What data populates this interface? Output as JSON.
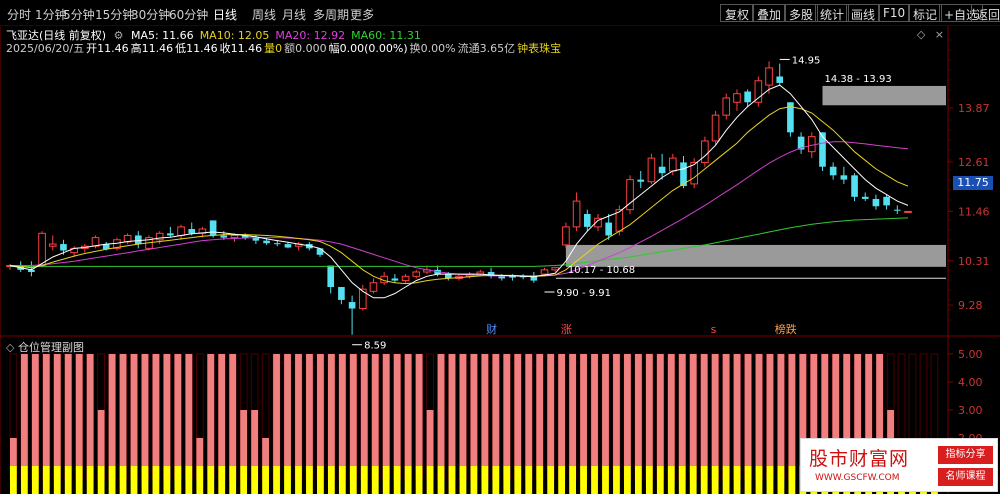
{
  "toolbar": {
    "periods": [
      "分时",
      "1分钟",
      "5分钟",
      "15分钟",
      "30分钟",
      "60分钟",
      "日线",
      "周线",
      "月线",
      "多周期",
      "更多"
    ],
    "active_period": "日线",
    "more_arrow": "›",
    "right_buttons": [
      "复权",
      "叠加",
      "多股",
      "统计",
      "画线",
      "F10",
      "标记",
      "+自选",
      "返回"
    ]
  },
  "info": {
    "stock": "飞亚达(日线 前复权)",
    "ma_items": [
      {
        "label": "MA5: 11.66",
        "color": "#ffffff"
      },
      {
        "label": "MA10: 12.05",
        "color": "#e6d21e"
      },
      {
        "label": "MA20: 12.92",
        "color": "#e040e0"
      },
      {
        "label": "MA60: 11.31",
        "color": "#32d232"
      }
    ],
    "line2": [
      {
        "text": "2025/06/20/五",
        "color": "#cccccc"
      },
      {
        "text": "开11.46",
        "color": "#ffffff"
      },
      {
        "text": "高11.46",
        "color": "#ffffff"
      },
      {
        "text": "低11.46",
        "color": "#ffffff"
      },
      {
        "text": "收11.46",
        "color": "#ffffff"
      },
      {
        "text": "量0",
        "color": "#e6d21e"
      },
      {
        "text": "额0.000",
        "color": "#cccccc"
      },
      {
        "text": "幅0.00(0.00%)",
        "color": "#ffffff"
      },
      {
        "text": "换0.00%",
        "color": "#cccccc"
      },
      {
        "text": "流通3.65亿",
        "color": "#cccccc"
      },
      {
        "text": "钟表珠宝",
        "color": "#e6d21e"
      }
    ]
  },
  "chart_data": {
    "type": "candlestick",
    "ylim": [
      8.7,
      15.1
    ],
    "y_ticks": [
      "13.87",
      "12.61",
      "11.46",
      "10.31",
      "9.28"
    ],
    "y_tick_values": [
      13.87,
      12.61,
      11.46,
      10.31,
      9.28
    ],
    "current_price": "11.75",
    "candles": [
      [
        10.18,
        10.24,
        10.1,
        10.2
      ],
      [
        10.2,
        10.3,
        10.05,
        10.1
      ],
      [
        10.1,
        10.3,
        9.95,
        10.05
      ],
      [
        10.2,
        11.0,
        10.15,
        10.95
      ],
      [
        10.65,
        10.9,
        10.55,
        10.7
      ],
      [
        10.7,
        10.8,
        10.45,
        10.55
      ],
      [
        10.5,
        10.65,
        10.4,
        10.6
      ],
      [
        10.6,
        10.7,
        10.5,
        10.65
      ],
      [
        10.65,
        10.9,
        10.6,
        10.85
      ],
      [
        10.7,
        10.75,
        10.55,
        10.58
      ],
      [
        10.6,
        10.85,
        10.55,
        10.8
      ],
      [
        10.75,
        10.95,
        10.7,
        10.9
      ],
      [
        10.9,
        11.0,
        10.6,
        10.7
      ],
      [
        10.6,
        10.9,
        10.55,
        10.85
      ],
      [
        10.8,
        11.0,
        10.7,
        10.95
      ],
      [
        10.95,
        11.1,
        10.85,
        10.9
      ],
      [
        10.9,
        11.15,
        10.8,
        11.1
      ],
      [
        11.05,
        11.2,
        10.9,
        10.95
      ],
      [
        10.95,
        11.1,
        10.85,
        11.05
      ],
      [
        11.25,
        11.25,
        10.85,
        10.9
      ],
      [
        10.9,
        11.0,
        10.8,
        10.85
      ],
      [
        10.85,
        10.95,
        10.75,
        10.9
      ],
      [
        10.9,
        10.95,
        10.8,
        10.85
      ],
      [
        10.85,
        10.9,
        10.7,
        10.78
      ],
      [
        10.78,
        10.85,
        10.68,
        10.72
      ],
      [
        10.72,
        10.8,
        10.65,
        10.7
      ],
      [
        10.7,
        10.75,
        10.6,
        10.62
      ],
      [
        10.65,
        10.75,
        10.55,
        10.7
      ],
      [
        10.7,
        10.75,
        10.55,
        10.6
      ],
      [
        10.6,
        10.6,
        10.4,
        10.45
      ],
      [
        10.2,
        10.2,
        9.55,
        9.7
      ],
      [
        9.7,
        9.7,
        9.3,
        9.4
      ],
      [
        9.35,
        9.5,
        8.59,
        9.2
      ],
      [
        9.2,
        9.75,
        9.15,
        9.65
      ],
      [
        9.6,
        9.9,
        9.55,
        9.8
      ],
      [
        9.8,
        10.05,
        9.75,
        9.95
      ],
      [
        9.9,
        10.0,
        9.8,
        9.85
      ],
      [
        9.85,
        10.0,
        9.8,
        9.95
      ],
      [
        9.95,
        10.1,
        9.9,
        10.05
      ],
      [
        10.05,
        10.2,
        10.0,
        10.1
      ],
      [
        10.1,
        10.2,
        9.95,
        10.0
      ],
      [
        10.0,
        10.05,
        9.85,
        9.9
      ],
      [
        9.9,
        10.0,
        9.85,
        9.95
      ],
      [
        9.95,
        10.05,
        9.9,
        10.0
      ],
      [
        10.0,
        10.1,
        9.95,
        10.05
      ],
      [
        10.05,
        10.15,
        9.9,
        9.95
      ],
      [
        9.95,
        10.0,
        9.85,
        9.9
      ],
      [
        9.95,
        10.0,
        9.85,
        9.92
      ],
      [
        9.95,
        10.0,
        9.88,
        9.94
      ],
      [
        9.95,
        10.05,
        9.8,
        9.85
      ],
      [
        10.0,
        10.15,
        9.95,
        10.1
      ],
      [
        10.1,
        10.17,
        10.05,
        10.15
      ],
      [
        10.68,
        11.2,
        10.6,
        11.1
      ],
      [
        11.1,
        11.9,
        11.0,
        11.7
      ],
      [
        11.4,
        11.5,
        11.0,
        11.1
      ],
      [
        11.1,
        11.4,
        11.0,
        11.3
      ],
      [
        11.2,
        11.4,
        10.8,
        10.9
      ],
      [
        11.0,
        11.6,
        10.9,
        11.5
      ],
      [
        11.5,
        12.3,
        11.4,
        12.2
      ],
      [
        12.2,
        12.4,
        12.0,
        12.15
      ],
      [
        12.15,
        12.8,
        12.1,
        12.7
      ],
      [
        12.5,
        12.8,
        12.2,
        12.35
      ],
      [
        12.4,
        12.8,
        12.3,
        12.7
      ],
      [
        12.6,
        12.75,
        12.0,
        12.05
      ],
      [
        12.1,
        12.7,
        12.0,
        12.6
      ],
      [
        12.6,
        13.2,
        12.5,
        13.1
      ],
      [
        13.1,
        13.8,
        13.0,
        13.7
      ],
      [
        13.7,
        14.2,
        13.6,
        14.1
      ],
      [
        14.0,
        14.3,
        13.8,
        14.2
      ],
      [
        14.25,
        14.3,
        13.9,
        14.0
      ],
      [
        14.0,
        14.6,
        13.9,
        14.5
      ],
      [
        14.4,
        14.95,
        14.2,
        14.8
      ],
      [
        14.6,
        14.9,
        14.4,
        14.45
      ],
      [
        14.0,
        14.0,
        13.2,
        13.3
      ],
      [
        13.2,
        13.3,
        12.8,
        12.9
      ],
      [
        12.85,
        13.3,
        12.7,
        13.2
      ],
      [
        13.3,
        13.3,
        12.4,
        12.5
      ],
      [
        12.5,
        12.6,
        12.2,
        12.3
      ],
      [
        12.3,
        12.5,
        12.1,
        12.2
      ],
      [
        12.3,
        12.35,
        11.7,
        11.8
      ],
      [
        11.8,
        11.9,
        11.7,
        11.75
      ],
      [
        11.75,
        11.85,
        11.5,
        11.58
      ],
      [
        11.8,
        11.85,
        11.5,
        11.6
      ],
      [
        11.5,
        11.6,
        11.4,
        11.48
      ],
      [
        11.46,
        11.46,
        11.46,
        11.46
      ]
    ],
    "ma5": [
      10.2,
      10.15,
      10.1,
      10.25,
      10.4,
      10.5,
      10.6,
      10.62,
      10.66,
      10.7,
      10.72,
      10.76,
      10.78,
      10.8,
      10.84,
      10.86,
      10.9,
      10.94,
      10.96,
      10.98,
      10.96,
      10.93,
      10.9,
      10.87,
      10.82,
      10.78,
      10.74,
      10.7,
      10.66,
      10.6,
      10.4,
      10.1,
      9.8,
      9.6,
      9.45,
      9.45,
      9.55,
      9.7,
      9.85,
      9.95,
      10.0,
      10.0,
      10.0,
      10.0,
      10.0,
      9.98,
      9.97,
      9.96,
      9.95,
      9.94,
      9.98,
      10.02,
      10.3,
      10.7,
      11.0,
      11.25,
      11.35,
      11.45,
      11.65,
      11.85,
      12.05,
      12.25,
      12.4,
      12.45,
      12.55,
      12.75,
      13.0,
      13.35,
      13.65,
      13.9,
      14.1,
      14.3,
      14.4,
      14.2,
      13.9,
      13.6,
      13.2,
      12.95,
      12.7,
      12.45,
      12.2,
      12.0,
      11.85,
      11.7,
      11.6
    ],
    "ma10": [
      10.2,
      10.18,
      10.15,
      10.2,
      10.28,
      10.35,
      10.42,
      10.48,
      10.53,
      10.58,
      10.62,
      10.66,
      10.7,
      10.73,
      10.76,
      10.79,
      10.82,
      10.85,
      10.88,
      10.9,
      10.92,
      10.92,
      10.92,
      10.91,
      10.9,
      10.88,
      10.86,
      10.83,
      10.8,
      10.76,
      10.65,
      10.5,
      10.3,
      10.1,
      9.95,
      9.85,
      9.8,
      9.78,
      9.8,
      9.85,
      9.88,
      9.9,
      9.92,
      9.94,
      9.96,
      9.97,
      9.97,
      9.97,
      9.96,
      9.95,
      9.96,
      9.98,
      10.1,
      10.3,
      10.5,
      10.7,
      10.85,
      11.0,
      11.15,
      11.35,
      11.55,
      11.75,
      11.95,
      12.1,
      12.25,
      12.45,
      12.65,
      12.85,
      13.05,
      13.3,
      13.5,
      13.7,
      13.85,
      13.9,
      13.85,
      13.75,
      13.55,
      13.35,
      13.1,
      12.85,
      12.65,
      12.45,
      12.3,
      12.15,
      12.05
    ],
    "ma20": [
      10.2,
      10.2,
      10.2,
      10.22,
      10.24,
      10.27,
      10.3,
      10.34,
      10.38,
      10.42,
      10.46,
      10.5,
      10.54,
      10.58,
      10.62,
      10.66,
      10.7,
      10.74,
      10.78,
      10.8,
      10.82,
      10.83,
      10.84,
      10.85,
      10.85,
      10.85,
      10.84,
      10.83,
      10.81,
      10.79,
      10.75,
      10.7,
      10.62,
      10.54,
      10.46,
      10.38,
      10.3,
      10.22,
      10.15,
      10.1,
      10.06,
      10.02,
      10.0,
      9.98,
      9.97,
      9.96,
      9.96,
      9.96,
      9.96,
      9.96,
      9.97,
      9.98,
      10.02,
      10.1,
      10.2,
      10.3,
      10.4,
      10.5,
      10.62,
      10.75,
      10.88,
      11.02,
      11.16,
      11.3,
      11.45,
      11.6,
      11.76,
      11.92,
      12.08,
      12.25,
      12.42,
      12.58,
      12.72,
      12.84,
      12.94,
      13.0,
      13.05,
      13.08,
      13.08,
      13.06,
      13.03,
      13.0,
      12.97,
      12.94,
      12.92
    ],
    "ma60": [
      10.18,
      10.18,
      10.18,
      10.18,
      10.18,
      10.18,
      10.18,
      10.18,
      10.18,
      10.18,
      10.18,
      10.18,
      10.18,
      10.18,
      10.18,
      10.18,
      10.18,
      10.18,
      10.18,
      10.18,
      10.18,
      10.18,
      10.18,
      10.18,
      10.18,
      10.18,
      10.18,
      10.18,
      10.18,
      10.18,
      10.18,
      10.18,
      10.18,
      10.18,
      10.18,
      10.18,
      10.18,
      10.18,
      10.18,
      10.18,
      10.18,
      10.18,
      10.18,
      10.18,
      10.18,
      10.18,
      10.18,
      10.18,
      10.18,
      10.18,
      10.19,
      10.2,
      10.22,
      10.25,
      10.28,
      10.31,
      10.34,
      10.37,
      10.4,
      10.44,
      10.48,
      10.52,
      10.56,
      10.6,
      10.64,
      10.68,
      10.73,
      10.78,
      10.83,
      10.88,
      10.93,
      10.98,
      11.03,
      11.08,
      11.12,
      11.16,
      11.19,
      11.22,
      11.24,
      11.26,
      11.27,
      11.28,
      11.29,
      11.3,
      11.31
    ],
    "zones": [
      {
        "label": "14.38 - 13.93",
        "top": 14.38,
        "bottom": 13.93,
        "start_index": 76
      },
      {
        "label": "10.17 - 10.68",
        "top": 10.68,
        "bottom": 10.17,
        "start_index": 52
      }
    ],
    "annotations": [
      {
        "text": "14.95",
        "value": 14.95,
        "index": 72
      },
      {
        "text": "8.59",
        "value": 8.59,
        "index": 32
      },
      {
        "text": "9.90 - 9.91",
        "value": 9.91,
        "index": 50
      }
    ],
    "event_markers": [
      {
        "text": "财",
        "index": 45,
        "color": "#4f8fff"
      },
      {
        "text": "涨",
        "index": 52,
        "color": "#ff4a4a"
      },
      {
        "text": "s",
        "index": 66,
        "color": "#ff4a4a"
      },
      {
        "text": "榜跌",
        "index": 72,
        "color": "#ff9f4a"
      }
    ]
  },
  "sub_chart": {
    "title": "仓位管理副图",
    "y_ticks": [
      "5.00",
      "4.00",
      "3.00",
      "2.00",
      "1.00"
    ],
    "y_tick_values": [
      5,
      4,
      3,
      2,
      1
    ],
    "bars": [
      2,
      2,
      2,
      5,
      5,
      5,
      5,
      5,
      5,
      5,
      5,
      5,
      5,
      5,
      5,
      5,
      5,
      5,
      5,
      5,
      5,
      5,
      3,
      3,
      3,
      2,
      5,
      5,
      5,
      5,
      5,
      5,
      5,
      5,
      5,
      5,
      3,
      3,
      3,
      3,
      3,
      5,
      5,
      5,
      5,
      5,
      5,
      5,
      5,
      5,
      5,
      5,
      5,
      5,
      5,
      5,
      5,
      5,
      5,
      5,
      5,
      5,
      5,
      5,
      5,
      5,
      5,
      5,
      5,
      5,
      5,
      5,
      3,
      2,
      2,
      2,
      2
    ],
    "bar_values_idx": [
      0,
      1,
      2,
      3,
      4,
      5,
      6,
      7,
      8,
      9,
      10,
      11,
      12,
      13,
      14,
      15,
      16,
      17,
      18,
      19,
      20,
      21,
      22,
      23,
      24,
      25,
      26,
      27,
      28,
      29,
      30,
      31,
      32,
      33,
      34,
      35,
      36,
      37,
      38,
      39,
      40,
      41,
      42,
      43,
      44,
      45,
      46,
      47,
      48,
      49,
      50,
      51,
      52,
      53,
      54,
      55,
      56,
      57,
      58,
      59,
      60,
      61,
      62,
      63,
      64,
      65,
      66,
      67,
      68,
      69,
      70,
      71,
      72,
      73,
      74,
      75,
      76
    ],
    "pos_values": [
      2,
      5,
      5,
      5,
      5,
      5,
      5,
      5,
      3,
      5,
      5,
      5,
      5,
      5,
      5,
      5,
      5,
      2,
      5,
      5,
      5,
      3,
      3,
      2,
      5,
      5,
      5,
      5,
      5,
      5,
      5,
      5,
      5,
      5,
      5,
      5,
      5,
      5,
      3,
      5,
      5,
      5,
      5,
      5,
      5,
      5,
      5,
      5,
      5,
      5,
      5,
      5,
      5,
      5,
      5,
      5,
      5,
      5,
      5,
      5,
      5,
      5,
      5,
      5,
      5,
      5,
      5,
      5,
      5,
      5,
      5,
      5,
      5,
      5,
      5,
      5,
      5,
      5,
      5,
      5,
      3,
      2,
      2,
      2,
      2
    ],
    "base_value": 1
  },
  "watermark": {
    "title": "股市财富网",
    "url": "WWW.GSCFW.COM",
    "tag1": "指标分享",
    "tag2": "名师课程"
  }
}
